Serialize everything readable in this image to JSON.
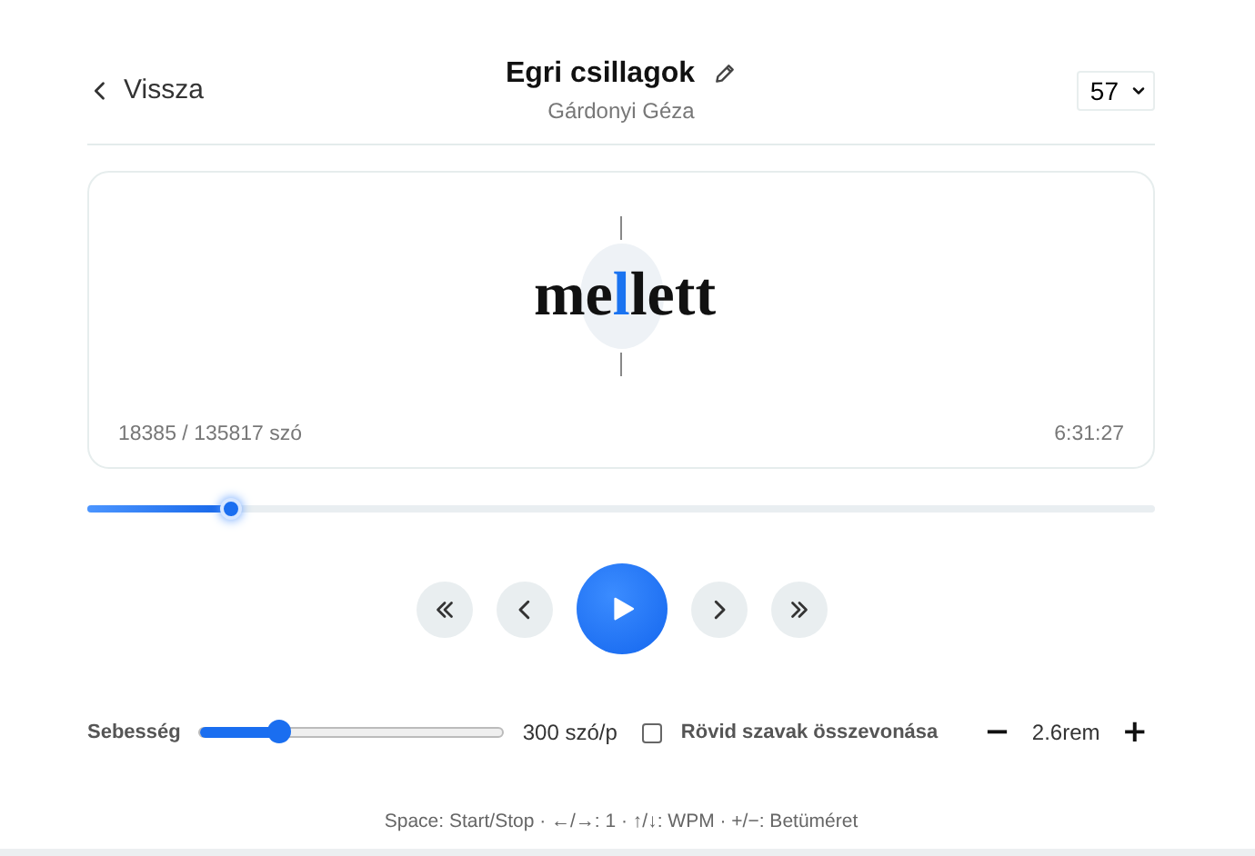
{
  "header": {
    "back": "Vissza",
    "title": "Egri csillagok",
    "author": "Gárdonyi Géza",
    "chapter_select": "57"
  },
  "reader": {
    "word_before": "me",
    "word_focus": "l",
    "word_after": "lett",
    "progress_text": "18385 / 135817 szó",
    "time_left": "6:31:27"
  },
  "progress": {
    "level": 0.135
  },
  "controls": [
    {
      "kind": "back-far"
    },
    {
      "kind": "back"
    },
    {
      "kind": "play"
    },
    {
      "kind": "forward"
    },
    {
      "kind": "forward-far"
    }
  ],
  "settings": {
    "speed_label": "Sebesség",
    "speed": {
      "level": 0.26
    },
    "speed_reading": "300 szó/p",
    "merge_short": {
      "label": "Rövid szavak összevonása",
      "checked": false
    },
    "font_minus": "−",
    "font_size": "2.6rem",
    "font_plus": "+"
  },
  "hint": "Space: Start/Stop · ←/→: 1 · ↑/↓: WPM · +/−: Betüméret"
}
